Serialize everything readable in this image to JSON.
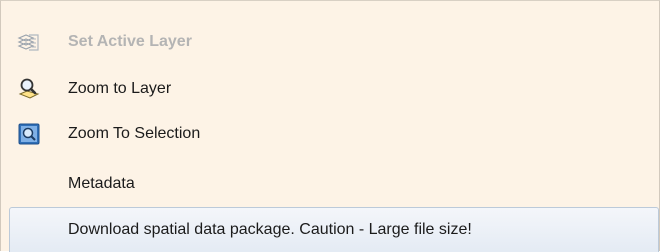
{
  "menu": {
    "items": [
      {
        "label": "Set Active Layer",
        "icon": "layers-icon",
        "enabled": false
      },
      {
        "label": "Zoom to Layer",
        "icon": "magnifier-icon",
        "enabled": true
      },
      {
        "label": "Zoom To Selection",
        "icon": "zoom-selection-icon",
        "enabled": true
      },
      {
        "label": "Metadata",
        "icon": "",
        "enabled": true
      },
      {
        "label": "Download spatial data package. Caution - Large file size!",
        "icon": "",
        "enabled": true,
        "highlighted": true
      }
    ]
  },
  "colors": {
    "menu_background": "#fdf3e6",
    "highlight_background": "#e4ebf4",
    "highlight_border": "#bccad9",
    "disabled_text": "#b4b4b4",
    "text": "#1b1b1b"
  }
}
